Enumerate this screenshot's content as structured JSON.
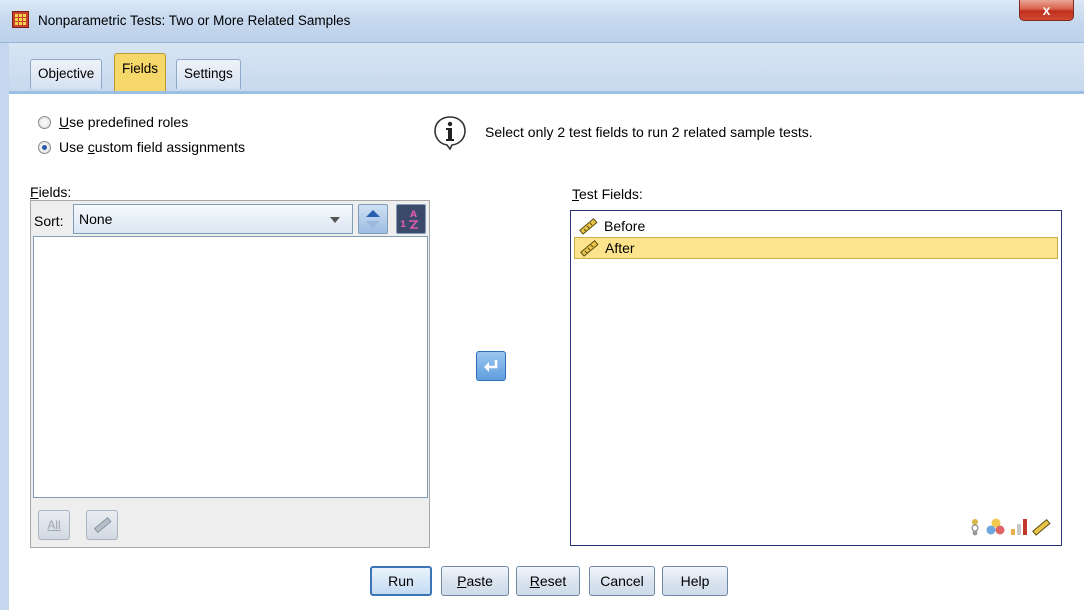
{
  "window": {
    "title": "Nonparametric Tests: Two or More Related Samples",
    "close_label": "x"
  },
  "tabs": [
    {
      "label": "Objective",
      "active": false
    },
    {
      "label": "Fields",
      "active": true
    },
    {
      "label": "Settings",
      "active": false
    }
  ],
  "roles": {
    "predefined": {
      "label_pre": "",
      "label_u": "U",
      "label_post": "se predefined roles",
      "checked": false
    },
    "custom": {
      "label_pre": "Use ",
      "label_u": "c",
      "label_post": "ustom field assignments",
      "checked": true
    }
  },
  "info": {
    "icon": "info-icon",
    "text": "Select only 2 test fields to run 2 related sample tests."
  },
  "fields": {
    "label_u": "F",
    "label_post": "ields:",
    "sort_label": "Sort:",
    "sort_value": "None",
    "items": [],
    "all_button": "All"
  },
  "test_fields": {
    "label_u": "T",
    "label_post": "est Fields:",
    "items": [
      {
        "name": "Before",
        "icon": "ruler-icon",
        "selected": false
      },
      {
        "name": "After",
        "icon": "ruler-icon",
        "selected": true
      }
    ]
  },
  "buttons": {
    "run": "Run",
    "paste_u": "P",
    "paste_post": "aste",
    "reset_u": "R",
    "reset_post": "eset",
    "cancel": "Cancel",
    "help": "Help"
  },
  "colors": {
    "selected_row": "#fde48c",
    "active_tab": "#f6d86a",
    "accent_border": "#27347a"
  }
}
